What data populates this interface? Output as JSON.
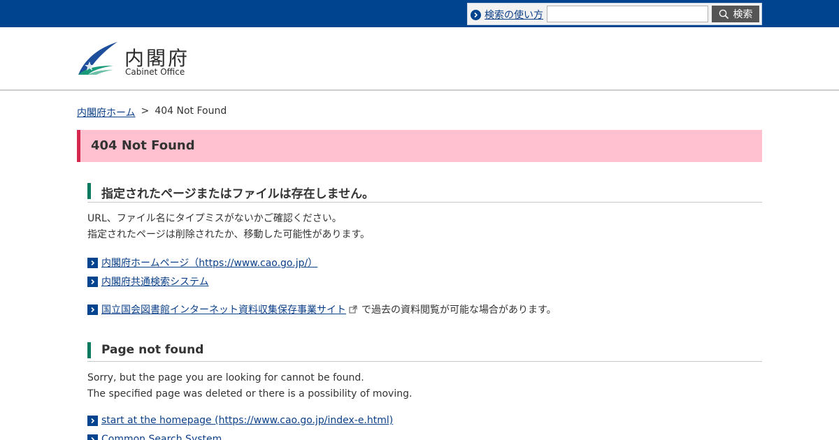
{
  "topbar": {
    "help_label": "検索の使い方",
    "search_placeholder": "",
    "search_button_label": "検索"
  },
  "header": {
    "logo_jp": "内閣府",
    "logo_en": "Cabinet Office"
  },
  "breadcrumb": {
    "home": "内閣府ホーム",
    "separator": ">",
    "current": "404 Not Found"
  },
  "page_title": "404 Not Found",
  "section_jp": {
    "heading": "指定されたページまたはファイルは存在しません。",
    "line1": "URL、ファイル名にタイプミスがないかご確認ください。",
    "line2": "指定されたページは削除されたか、移動した可能性があります。",
    "links": [
      {
        "label": "内閣府ホームページ（https://www.cao.go.jp/）"
      },
      {
        "label": "内閣府共通検索システム"
      },
      {
        "label": "国立国会図書館インターネット資料収集保存事業サイト",
        "suffix": "で過去の資料閲覧が可能な場合があります。"
      }
    ]
  },
  "section_en": {
    "heading": "Page not found",
    "line1": "Sorry, but the page you are looking for cannot be found.",
    "line2": "The specified page was deleted or there is a possibility of moving.",
    "links": [
      {
        "label": "start at the homepage (https://www.cao.go.jp/index-e.html)"
      },
      {
        "label": "Common Search System"
      }
    ]
  },
  "colors": {
    "brand_blue": "#00448f",
    "title_bg": "#ffc0cf",
    "title_accent": "#d6284f",
    "heading_accent": "#0c7a5e"
  }
}
